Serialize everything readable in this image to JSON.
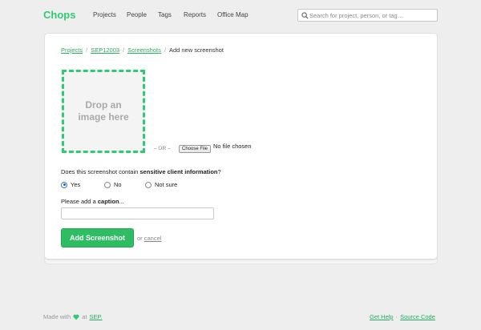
{
  "nav": {
    "brand": "Chops",
    "links": [
      "Projects",
      "People",
      "Tags",
      "Reports",
      "Office Map"
    ],
    "search_placeholder": "Search for project, person, or tag…"
  },
  "breadcrumb": {
    "items": [
      "Projects",
      "SEP12003",
      "Screenshots"
    ],
    "current": "Add new screenshot",
    "separator": "/"
  },
  "upload": {
    "dropzone_text": "Drop an image here",
    "or_text": "– OR –",
    "choose_file_label": "Choose File",
    "file_status": "No file chosen"
  },
  "form": {
    "question_prefix": "Does this screenshot contain ",
    "question_bold": "sensitive client information",
    "question_suffix": "?",
    "options": [
      "Yes",
      "No",
      "Not sure"
    ],
    "selected_option": "Yes",
    "caption_prefix": "Please add a ",
    "caption_bold": "caption",
    "caption_suffix": "...",
    "caption_value": "",
    "submit_label": "Add Screenshot",
    "or_label": "or",
    "cancel_label": "cancel"
  },
  "footer": {
    "made_with": "Made with",
    "at": "at",
    "company": "SEP.",
    "help_link": "Get Help",
    "separator": "·",
    "source_link": "Source Code"
  },
  "colors": {
    "accent": "#2ecc71",
    "link": "#27ae60",
    "button": "#2ebd63"
  }
}
